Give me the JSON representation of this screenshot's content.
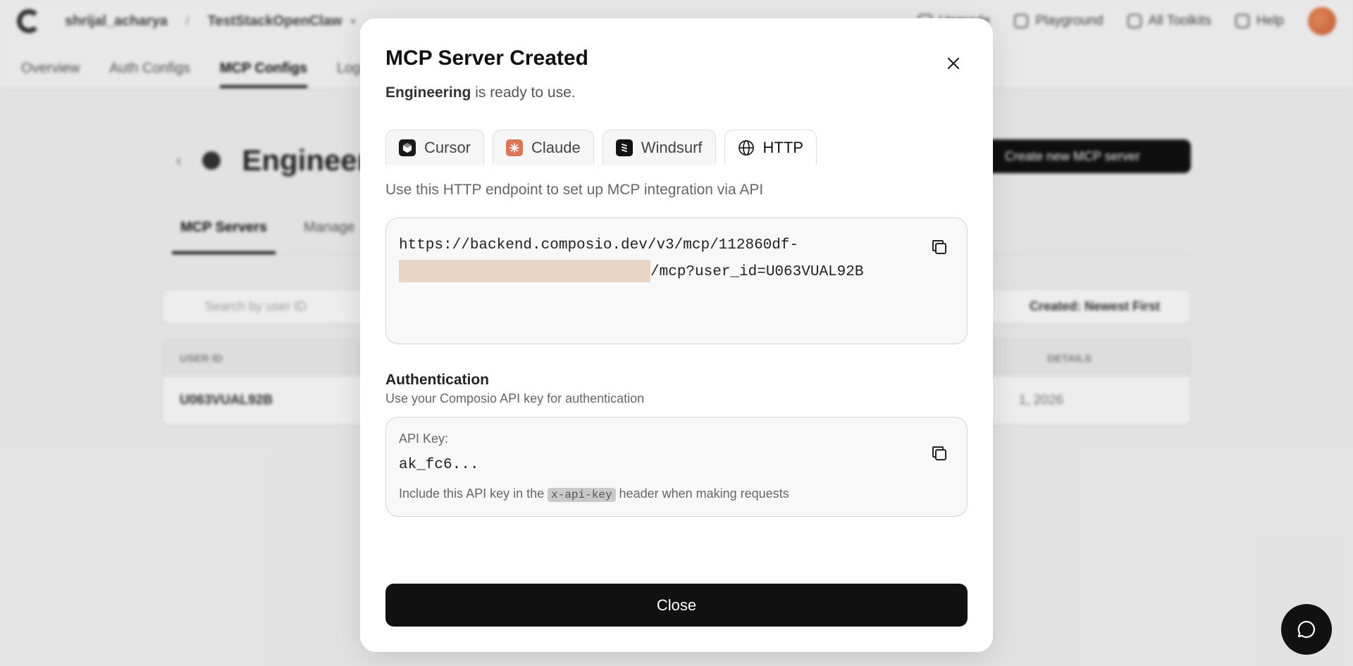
{
  "background": {
    "account": "shrijal_acharya",
    "project": "TestStackOpenClaw",
    "topnav": [
      "Upgrade",
      "Playground",
      "All Toolkits",
      "Help"
    ],
    "subnav": [
      "Overview",
      "Auth Configs",
      "MCP Configs",
      "Logs"
    ],
    "page_title": "Engineering",
    "create_button": "Create new MCP server",
    "tabs": [
      "MCP Servers",
      "Manage"
    ],
    "search_placeholder": "Search by user ID",
    "sort_label": "Created: Newest First",
    "table_headers": [
      "USER ID",
      "DETAILS"
    ],
    "row_user_id": "U063VUAL92B",
    "row_date": "1, 2026"
  },
  "modal": {
    "title": "MCP Server Created",
    "server_name": "Engineering",
    "subtitle_suffix": " is ready to use.",
    "tabs": [
      {
        "label": "Cursor",
        "icon": "cursor-logo-icon"
      },
      {
        "label": "Claude",
        "icon": "claude-logo-icon"
      },
      {
        "label": "Windsurf",
        "icon": "windsurf-logo-icon"
      },
      {
        "label": "HTTP",
        "icon": "globe-icon",
        "active": true
      }
    ],
    "description": "Use this HTTP endpoint to set up MCP integration via API",
    "endpoint_prefix": "https://backend.composio.dev/v3/mcp/112860df-",
    "endpoint_suffix": "/mcp?user_id=U063VUAL92B",
    "auth_title": "Authentication",
    "auth_subtitle": "Use your Composio API key for authentication",
    "api_key_label": "API Key:",
    "api_key_value": "ak_fc6...",
    "api_note_prefix": "Include this API key in the ",
    "api_note_code": "x-api-key",
    "api_note_suffix": " header when making requests",
    "close_label": "Close"
  },
  "colors": {
    "primary_button": "#111111",
    "redaction": "#e8d5c6",
    "claude_brand": "#d97757"
  }
}
